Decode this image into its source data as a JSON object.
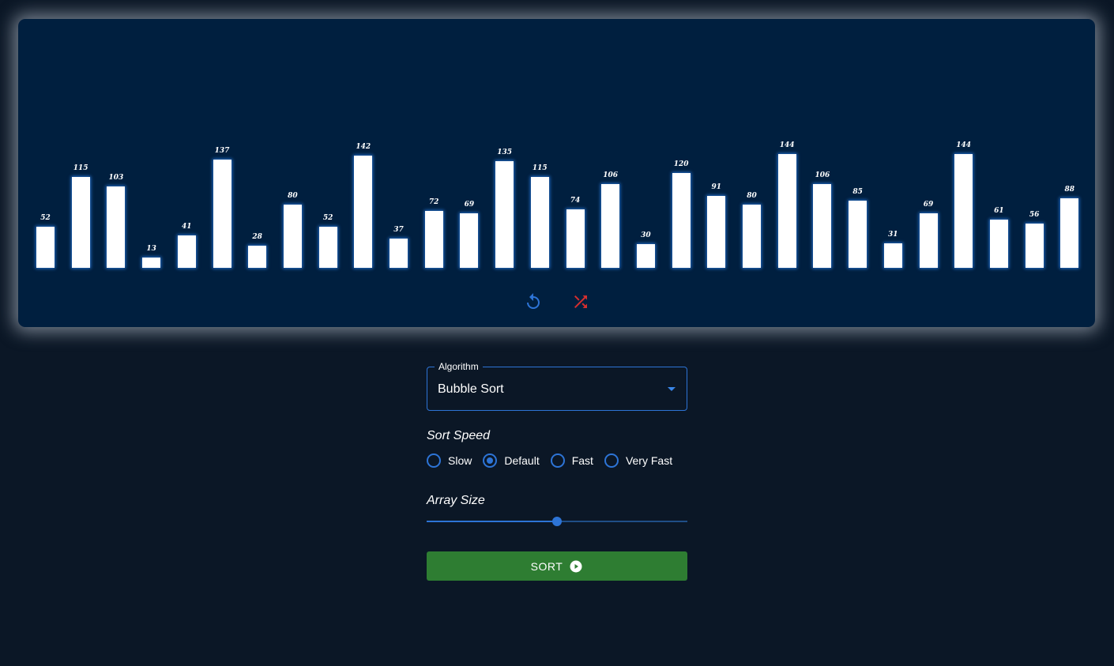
{
  "visualizer": {
    "bar_color": "#ffffff",
    "glow_color": "#2878dc",
    "panel_color": "#001f3f",
    "reset_icon": "reset-icon",
    "shuffle_icon": "shuffle-icon"
  },
  "chart_data": {
    "type": "bar",
    "values": [
      52,
      115,
      103,
      13,
      41,
      137,
      28,
      80,
      52,
      142,
      37,
      72,
      69,
      135,
      115,
      74,
      106,
      30,
      120,
      91,
      80,
      144,
      106,
      85,
      31,
      69,
      144,
      61,
      56,
      88
    ],
    "ylim": [
      0,
      144
    ]
  },
  "controls": {
    "algorithm": {
      "label": "Algorithm",
      "value": "Bubble Sort"
    },
    "speed": {
      "title": "Sort Speed",
      "options": [
        {
          "label": "Slow",
          "checked": false
        },
        {
          "label": "Default",
          "checked": true
        },
        {
          "label": "Fast",
          "checked": false
        },
        {
          "label": "Very Fast",
          "checked": false
        }
      ]
    },
    "array_size": {
      "title": "Array Size",
      "fraction": 0.5
    },
    "sort_button": {
      "label": "SORT",
      "icon": "play-circle-icon",
      "color": "#2e7d32"
    }
  }
}
